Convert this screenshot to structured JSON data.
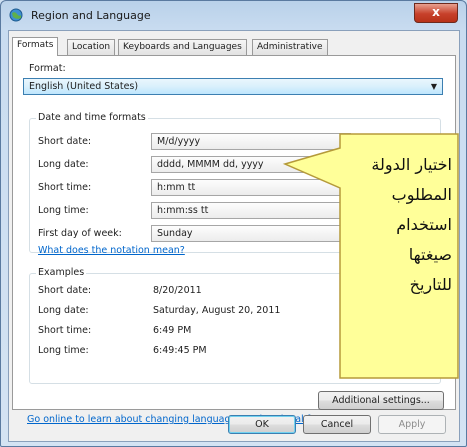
{
  "window": {
    "title": "Region and Language",
    "close_glyph": "x"
  },
  "tabs": [
    {
      "label": "Formats",
      "active": true
    },
    {
      "label": "Location",
      "active": false
    },
    {
      "label": "Keyboards and Languages",
      "active": false
    },
    {
      "label": "Administrative",
      "active": false
    }
  ],
  "format": {
    "label": "Format:",
    "value": "English (United States)"
  },
  "date_time": {
    "title": "Date and time formats",
    "rows": [
      {
        "label": "Short date:",
        "value": "M/d/yyyy"
      },
      {
        "label": "Long date:",
        "value": "dddd, MMMM dd, yyyy"
      },
      {
        "label": "Short time:",
        "value": "h:mm tt"
      },
      {
        "label": "Long time:",
        "value": "h:mm:ss tt"
      },
      {
        "label": "First day of week:",
        "value": "Sunday"
      }
    ],
    "notation_link": "What does the notation mean?"
  },
  "examples": {
    "title": "Examples",
    "rows": [
      {
        "label": "Short date:",
        "value": "8/20/2011"
      },
      {
        "label": "Long date:",
        "value": "Saturday, August 20, 2011"
      },
      {
        "label": "Short time:",
        "value": "6:49 PM"
      },
      {
        "label": "Long time:",
        "value": "6:49:45 PM"
      }
    ]
  },
  "additional_settings_label": "Additional settings...",
  "online_link": "Go online to learn about changing languages and regional formats",
  "buttons": {
    "ok": "OK",
    "cancel": "Cancel",
    "apply": "Apply"
  },
  "callout": {
    "lines": [
      "اختيار الدولة",
      "المطلوب",
      "استخدام",
      "صيغتها",
      "للتاريخ"
    ],
    "fill": "#ffff99",
    "stroke": "#b59a3a"
  },
  "colors": {
    "link": "#0066cc",
    "close_button": "#c7402a"
  }
}
